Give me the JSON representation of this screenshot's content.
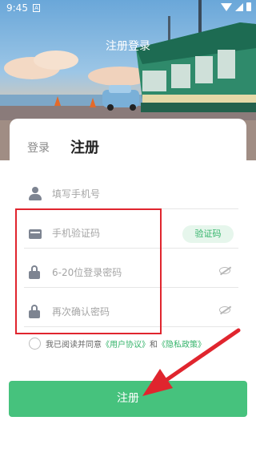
{
  "status_bar": {
    "time": "9:45",
    "notice_icon_letter": "A"
  },
  "header": {
    "title": "注册登录"
  },
  "tabs": {
    "login": "登录",
    "register": "注册"
  },
  "fields": {
    "phone": {
      "placeholder": "填写手机号",
      "icon": "user-icon"
    },
    "sms_code": {
      "placeholder": "手机验证码",
      "icon": "mail-icon",
      "button": "验证码"
    },
    "password": {
      "placeholder": "6-20位登录密码",
      "icon": "lock-icon"
    },
    "confirm_password": {
      "placeholder": "再次确认密码",
      "icon": "lock-icon"
    }
  },
  "agreement": {
    "prefix": "我已阅读并同意",
    "user_agreement": "《用户协议》",
    "and": "和",
    "privacy_policy": "《隐私政策》"
  },
  "submit": {
    "label": "注册"
  },
  "colors": {
    "accent": "#46c27d",
    "highlight": "#e0252e"
  }
}
